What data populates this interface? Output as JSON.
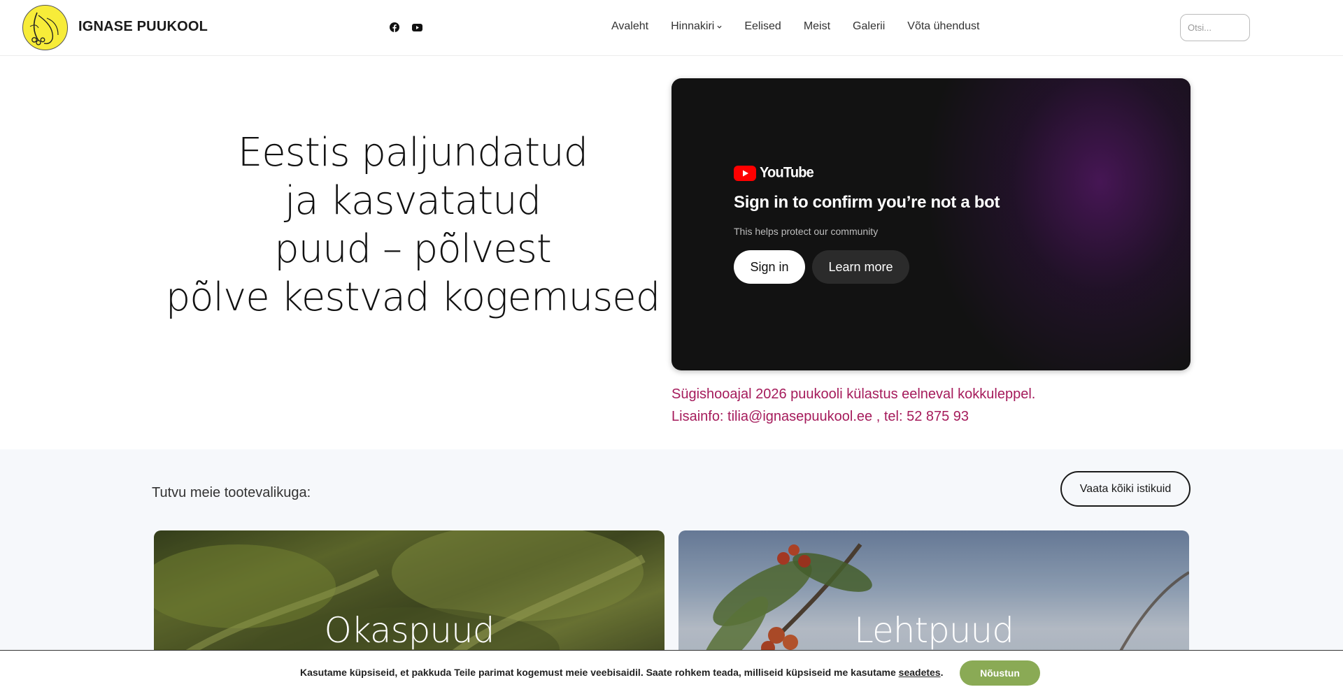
{
  "header": {
    "site_name": "IGNASE PUUKOOL",
    "social": [
      "facebook-icon",
      "youtube-icon"
    ],
    "nav": [
      {
        "label": "Avaleht"
      },
      {
        "label": "Hinnakiri",
        "has_dropdown": true
      },
      {
        "label": "Eelised"
      },
      {
        "label": "Meist"
      },
      {
        "label": "Galerii"
      },
      {
        "label": "Võta ühendust"
      }
    ],
    "search_placeholder": "Otsi..."
  },
  "hero": {
    "lines": [
      "Eestis paljundatud",
      "ja kasvatatud",
      "puud – põlvest",
      "põlve kestvad kogemused"
    ]
  },
  "video": {
    "brand": "YouTube",
    "title": "Sign in to confirm you’re not a bot",
    "subtitle": "This helps protect our community",
    "sign_in_label": "Sign in",
    "learn_more_label": "Learn more"
  },
  "notice": {
    "line1": "Sügishooajal 2026 puukooli külastus eelneval kokkuleppel.",
    "line2": "Lisainfo: tilia@ignasepuukool.ee , tel: 52 875 93"
  },
  "products": {
    "label": "Tutvu meie tootevalikuga:",
    "view_all_label": "Vaata kõiki istikuid",
    "cards": [
      {
        "title": "Okaspuud"
      },
      {
        "title": "Lehtpuud"
      }
    ]
  },
  "cookie": {
    "text": "Kasutame küpsiseid, et pakkuda Teile parimat kogemust meie veebisaidil. Saate rohkem teada, milliseid küpsiseid me kasutame",
    "link_label": "seadetes",
    "suffix": ".",
    "accept_label": "Nõustun"
  },
  "colors": {
    "accent_notice": "#a51b5b",
    "accept_button": "#8aaa55",
    "logo_background": "#f7ec39",
    "youtube_red": "#ff0000"
  }
}
